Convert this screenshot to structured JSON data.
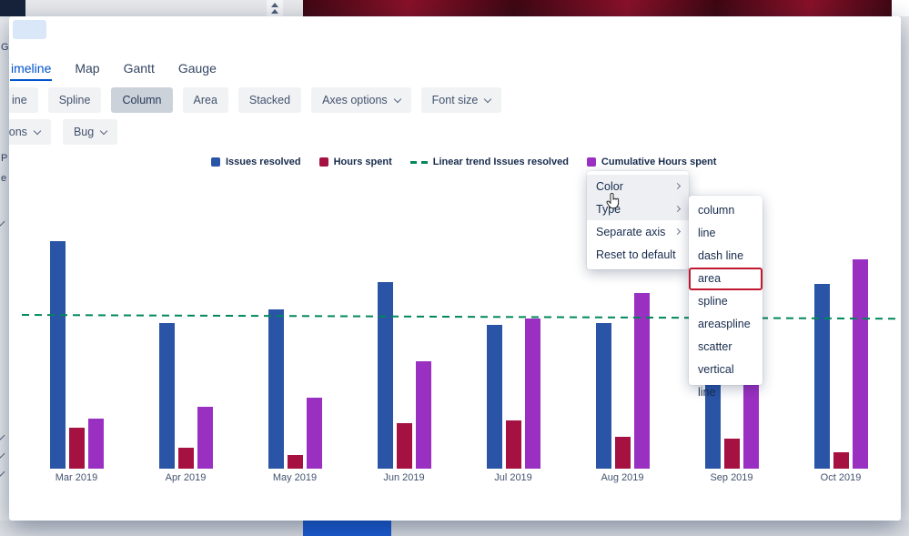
{
  "page": {
    "background": {
      "banner_color_a": "#3f0712",
      "banner_color_b": "#8a1128",
      "left_fragments": [
        "Ge",
        "P",
        "e"
      ],
      "bottom_button_color": "#1c5dd6"
    }
  },
  "dialog": {
    "tabs": [
      {
        "label": "imeline",
        "active": true
      },
      {
        "label": "Map",
        "active": false
      },
      {
        "label": "Gantt",
        "active": false
      },
      {
        "label": "Gauge",
        "active": false
      }
    ],
    "chart_type_buttons": [
      {
        "label": "ine"
      },
      {
        "label": "Spline"
      },
      {
        "label": "Column",
        "active": true
      },
      {
        "label": "Area"
      },
      {
        "label": "Stacked"
      },
      {
        "label": "Axes options",
        "dropdown": true
      },
      {
        "label": "Font size",
        "dropdown": true
      }
    ],
    "filter_buttons": [
      {
        "label": "ions",
        "dropdown": true
      },
      {
        "label": "Bug",
        "dropdown": true
      }
    ],
    "context_menu": {
      "items": [
        {
          "label": "Color",
          "submenu": true,
          "shaded": true
        },
        {
          "label": "Type",
          "submenu": true,
          "shaded": true
        },
        {
          "label": "Separate axis",
          "submenu": true,
          "shaded": false
        },
        {
          "label": "Reset to default",
          "submenu": false,
          "shaded": false
        }
      ]
    },
    "type_submenu": {
      "items": [
        "column",
        "line",
        "dash line",
        "area",
        "spline",
        "areaspline",
        "scatter",
        "vertical line"
      ],
      "highlighted": "area",
      "highlight_border": "#c0182f"
    }
  },
  "chart_data": {
    "type": "bar",
    "title": "",
    "categories": [
      "Mar 2019",
      "Apr 2019",
      "May 2019",
      "Jun 2019",
      "Jul 2019",
      "Aug 2019",
      "Sep 2019",
      "Oct 2019"
    ],
    "series": [
      {
        "name": "Issues resolved",
        "color": "#2a54a5",
        "values": [
          100,
          64,
          70,
          82,
          63,
          64,
          81,
          81
        ]
      },
      {
        "name": "Hours spent",
        "color": "#a51140",
        "values": [
          18,
          9,
          6,
          20,
          21,
          14,
          13,
          7
        ]
      },
      {
        "name": "Cumulative Hours spent",
        "color": "#9a30c2",
        "values": [
          22,
          27,
          31,
          47,
          66,
          77,
          84,
          92
        ]
      }
    ],
    "trend": {
      "name": "Linear trend Issues resolved",
      "color": "#00875a",
      "style": "dashed",
      "start_value": 68,
      "end_value": 66
    },
    "legend": [
      {
        "label": "Issues resolved",
        "color": "#2a54a5",
        "marker": "square"
      },
      {
        "label": "Hours spent",
        "color": "#a51140",
        "marker": "square"
      },
      {
        "label": "Linear trend Issues resolved",
        "color": "#00875a",
        "marker": "dash"
      },
      {
        "label": "Cumulative Hours spent",
        "color": "#9a30c2",
        "marker": "square"
      }
    ],
    "ylim": [
      0,
      105
    ],
    "grid": false,
    "legend_position": "top"
  }
}
